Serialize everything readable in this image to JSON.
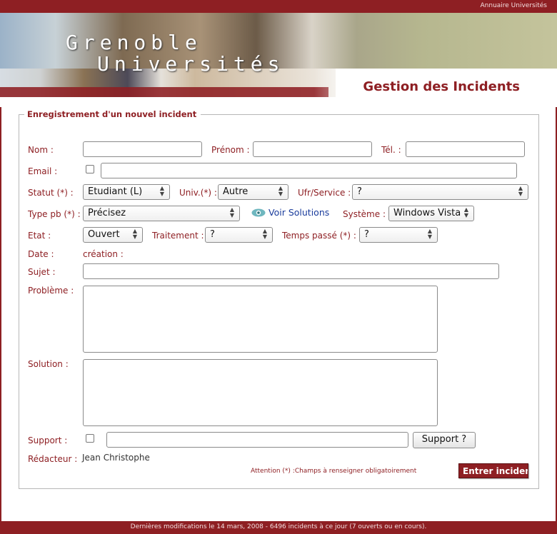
{
  "header": {
    "top_link": "Annuaire Universités",
    "brand_line1": "Grenoble",
    "brand_line2": "Universités",
    "app_title": "Gestion des Incidents"
  },
  "form": {
    "legend": "Enregistrement d'un nouvel incident",
    "labels": {
      "nom": "Nom :",
      "prenom": "Prénom :",
      "tel": "Tél. :",
      "email": "Email :",
      "statut": "Statut (*) :",
      "univ": "Univ.(*) :",
      "ufr": "Ufr/Service :",
      "type_pb": "Type pb (*) :",
      "systeme": "Système :",
      "etat": "Etat :",
      "traitement": "Traitement :",
      "temps_passe": "Temps passé (*) :",
      "date": "Date :",
      "sujet": "Sujet :",
      "probleme": "Problème :",
      "solution": "Solution :",
      "support": "Support :",
      "redacteur": "Rédacteur :"
    },
    "values": {
      "nom": "",
      "prenom": "",
      "tel": "",
      "email": "",
      "statut": "Etudiant (L)",
      "univ": "Autre",
      "ufr": "?",
      "type_pb": "Précisez",
      "systeme": "Windows Vista",
      "etat": "Ouvert",
      "traitement": "?",
      "temps_passe": "?",
      "date_text": "création :",
      "sujet": "",
      "probleme": "",
      "solution": "",
      "support": "",
      "redacteur": "Jean Christophe"
    },
    "voir_solutions": "Voir Solutions",
    "support_button": "Support ?",
    "note": "Attention (*) :Champs à renseigner obligatoirement",
    "submit": "Entrer incident"
  },
  "footer": {
    "text": "Dernières modifications le 14 mars, 2008   -   6496 incidents à ce jour (7 ouverts ou en cours)."
  },
  "colors": {
    "brand": "#8e1f23",
    "link": "#1a3c9c"
  }
}
